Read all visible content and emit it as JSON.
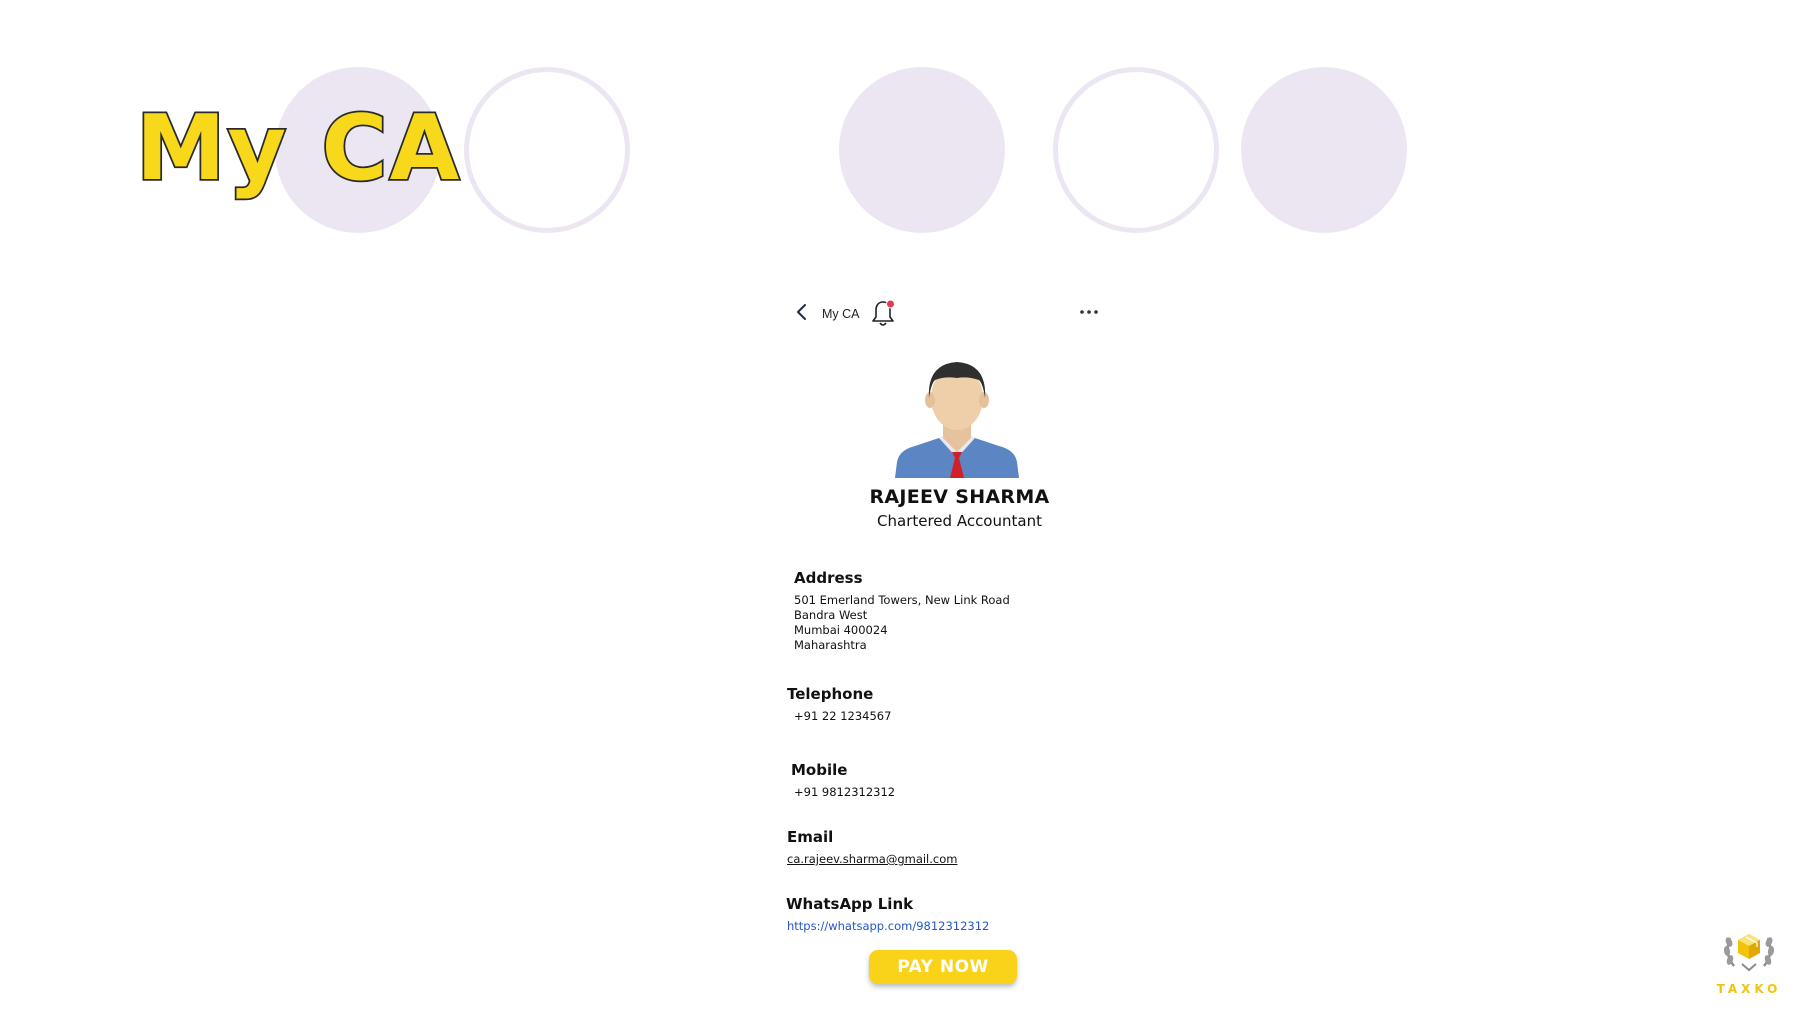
{
  "slide": {
    "title": "My CA"
  },
  "app": {
    "topbar": {
      "title": "My CA",
      "back_icon": "chevron-left-icon",
      "bell_icon": "bell-icon",
      "more_icon": "more-horizontal-icon"
    },
    "profile": {
      "name": "RAJEEV SHARMA",
      "role": "Chartered Accountant",
      "avatar_icon": "male-avatar-illustration"
    },
    "details": {
      "address": {
        "label": "Address",
        "lines": [
          "501 Emerland Towers, New Link Road",
          "Bandra West",
          "Mumbai 400024",
          "Maharashtra"
        ]
      },
      "telephone": {
        "label": "Telephone",
        "value": "+91 22 1234567"
      },
      "mobile": {
        "label": "Mobile",
        "value": "+91 9812312312"
      },
      "email": {
        "label": "Email",
        "value": "ca.rajeev.sharma@gmail.com"
      },
      "whatsapp": {
        "label": "WhatsApp Link",
        "value": "https://whatsapp.com/9812312312"
      }
    },
    "pay_button": {
      "label": "PAY NOW"
    }
  },
  "brand": {
    "name": "TAXKO",
    "logo_icon": "laurel-box-logo"
  },
  "colors": {
    "accent_yellow": "#f9d21a",
    "decor_lavender": "#ece6f3",
    "link_blue": "#2456c9",
    "notification_red": "#e53950"
  }
}
